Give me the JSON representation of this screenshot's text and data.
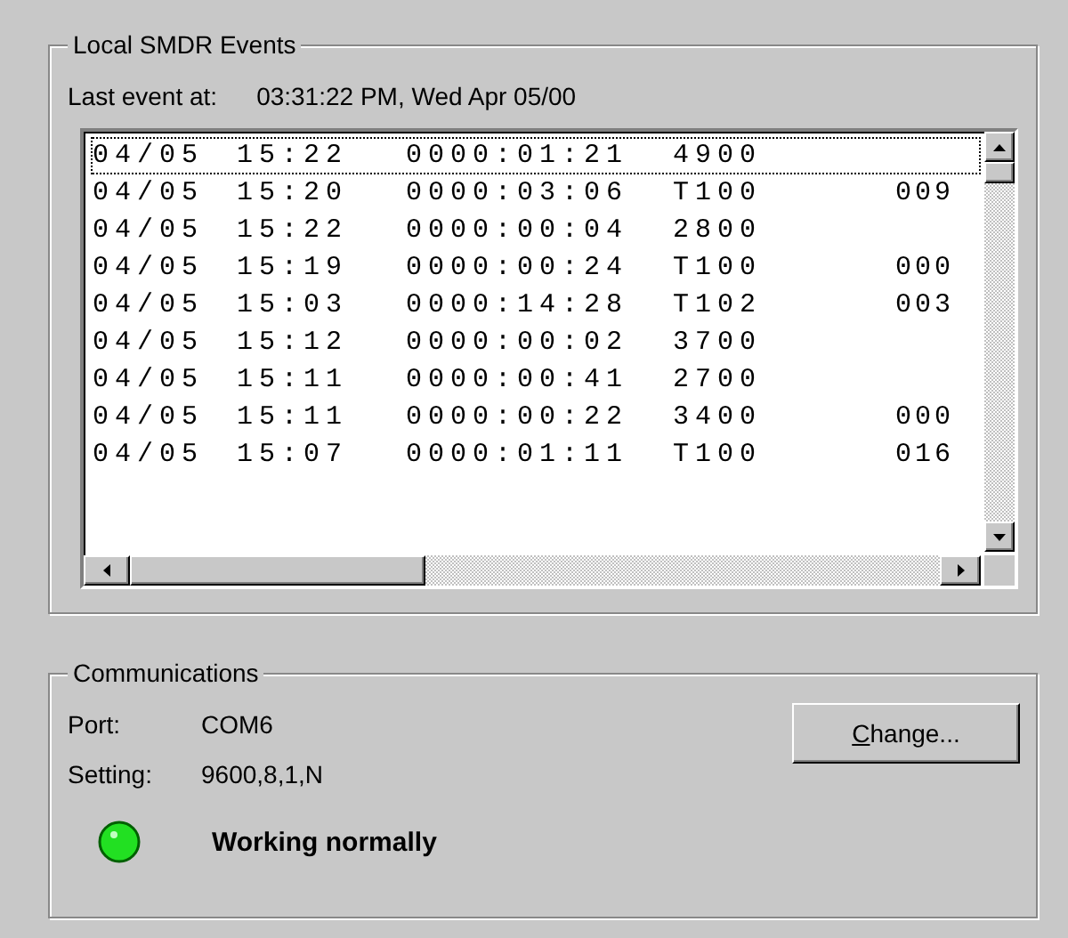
{
  "events_group": {
    "title": "Local SMDR Events",
    "last_event_label": "Last event at:",
    "last_event_value": "03:31:22 PM,  Wed Apr 05/00",
    "rows": [
      {
        "date": "04/05",
        "time": "15:22",
        "duration": "0000:01:21",
        "extension": "4900",
        "selected": true
      },
      {
        "date": "04/05",
        "time": "15:20",
        "duration": "0000:03:06",
        "extension": "T100",
        "column_5": "009",
        "selected": false
      },
      {
        "date": "04/05",
        "time": "15:22",
        "duration": "0000:00:04",
        "extension": "2800",
        "selected": false
      },
      {
        "date": "04/05",
        "time": "15:19",
        "duration": "0000:00:24",
        "extension": "T100",
        "column_5": "000",
        "selected": false
      },
      {
        "date": "04/05",
        "time": "15:03",
        "duration": "0000:14:28",
        "extension": "T102",
        "column_5": "003",
        "selected": false
      },
      {
        "date": "04/05",
        "time": "15:12",
        "duration": "0000:00:02",
        "extension": "3700",
        "selected": false
      },
      {
        "date": "04/05",
        "time": "15:11",
        "duration": "0000:00:41",
        "extension": "2700",
        "selected": false
      },
      {
        "date": "04/05",
        "time": "15:11",
        "duration": "0000:00:22",
        "extension": "3400",
        "column_5": "000",
        "selected": false
      },
      {
        "date": "04/05",
        "time": "15:07",
        "duration": "0000:01:11",
        "extension": "T100",
        "column_5": "016",
        "selected": false
      }
    ]
  },
  "communications_group": {
    "title": "Communications",
    "port_label": "Port:",
    "port_value": "COM6",
    "setting_label": "Setting:",
    "setting_value": "9600,8,1,N",
    "change_button": "Change...",
    "status": {
      "ok": true,
      "text": "Working normally"
    }
  }
}
